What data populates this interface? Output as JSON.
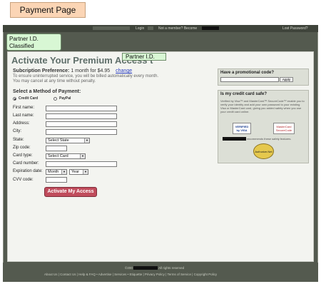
{
  "page_label": "Payment Page",
  "topbar": {
    "login": "Login",
    "not_member": "Not a member? Become",
    "lost_password": "Lost Password?"
  },
  "partner_annotation_1": "Partner I.D. Classified",
  "partner_annotation_2": "Partner I.D.",
  "title": "Activate Your Premium Access t",
  "subscription": {
    "label": "Subcription Preference:",
    "value": "1 month for $4.95",
    "change_link": "change",
    "note1": "To ensure uninterrupted service, you will be billed automatically every month.",
    "note2": "You may cancel at any time without penalty."
  },
  "payment_method": {
    "heading": "Select a Method of Payment:",
    "options": [
      "Credit Card",
      "PayPal"
    ],
    "selected": "Credit Card"
  },
  "form": {
    "first_name": "First name:",
    "last_name": "Last name:",
    "address": "Address:",
    "city": "City:",
    "state": "State:",
    "state_value": "Select State",
    "zip": "Zip code:",
    "card_type": "Card type:",
    "card_type_value": "Select Card",
    "card_number": "Card number:",
    "expiration": "Expiration date:",
    "month": "Month",
    "year": "Year",
    "cvv": "CVV code:"
  },
  "activate_button": "Activate My Access",
  "promo": {
    "heading": "Have a promotional code?",
    "apply": "Apply"
  },
  "safe": {
    "heading": "Is my credit card safe?",
    "text": "Verified by Visa™ and MasterCard™ SecureCode™ enable you to verify your identity and add your own password to your existing Visa or MasterCard card, giving you added safety when you use your credit card online.",
    "visa": "VERIFIED by VISA",
    "mastercard": "MasterCard SecureCode",
    "recommends": "recommends these safety features.",
    "authorize": "Authorize.Net"
  },
  "footer": {
    "copyright_prefix": "©200",
    "copyright_suffix": "All rights reserved",
    "links": "About Us | Contact Us | Help & FAQ  •  Advertise | Services  •  Etiquette | Privacy Policy | Terms of Service | Copyright Policy"
  },
  "colors": {
    "frame": "#545a4f",
    "content": "#f3f4f0",
    "title": "#5f6f6a",
    "button": "#c04c5c",
    "annotation": "#d8f7d4",
    "page_label_bg": "#fbd5b5"
  }
}
